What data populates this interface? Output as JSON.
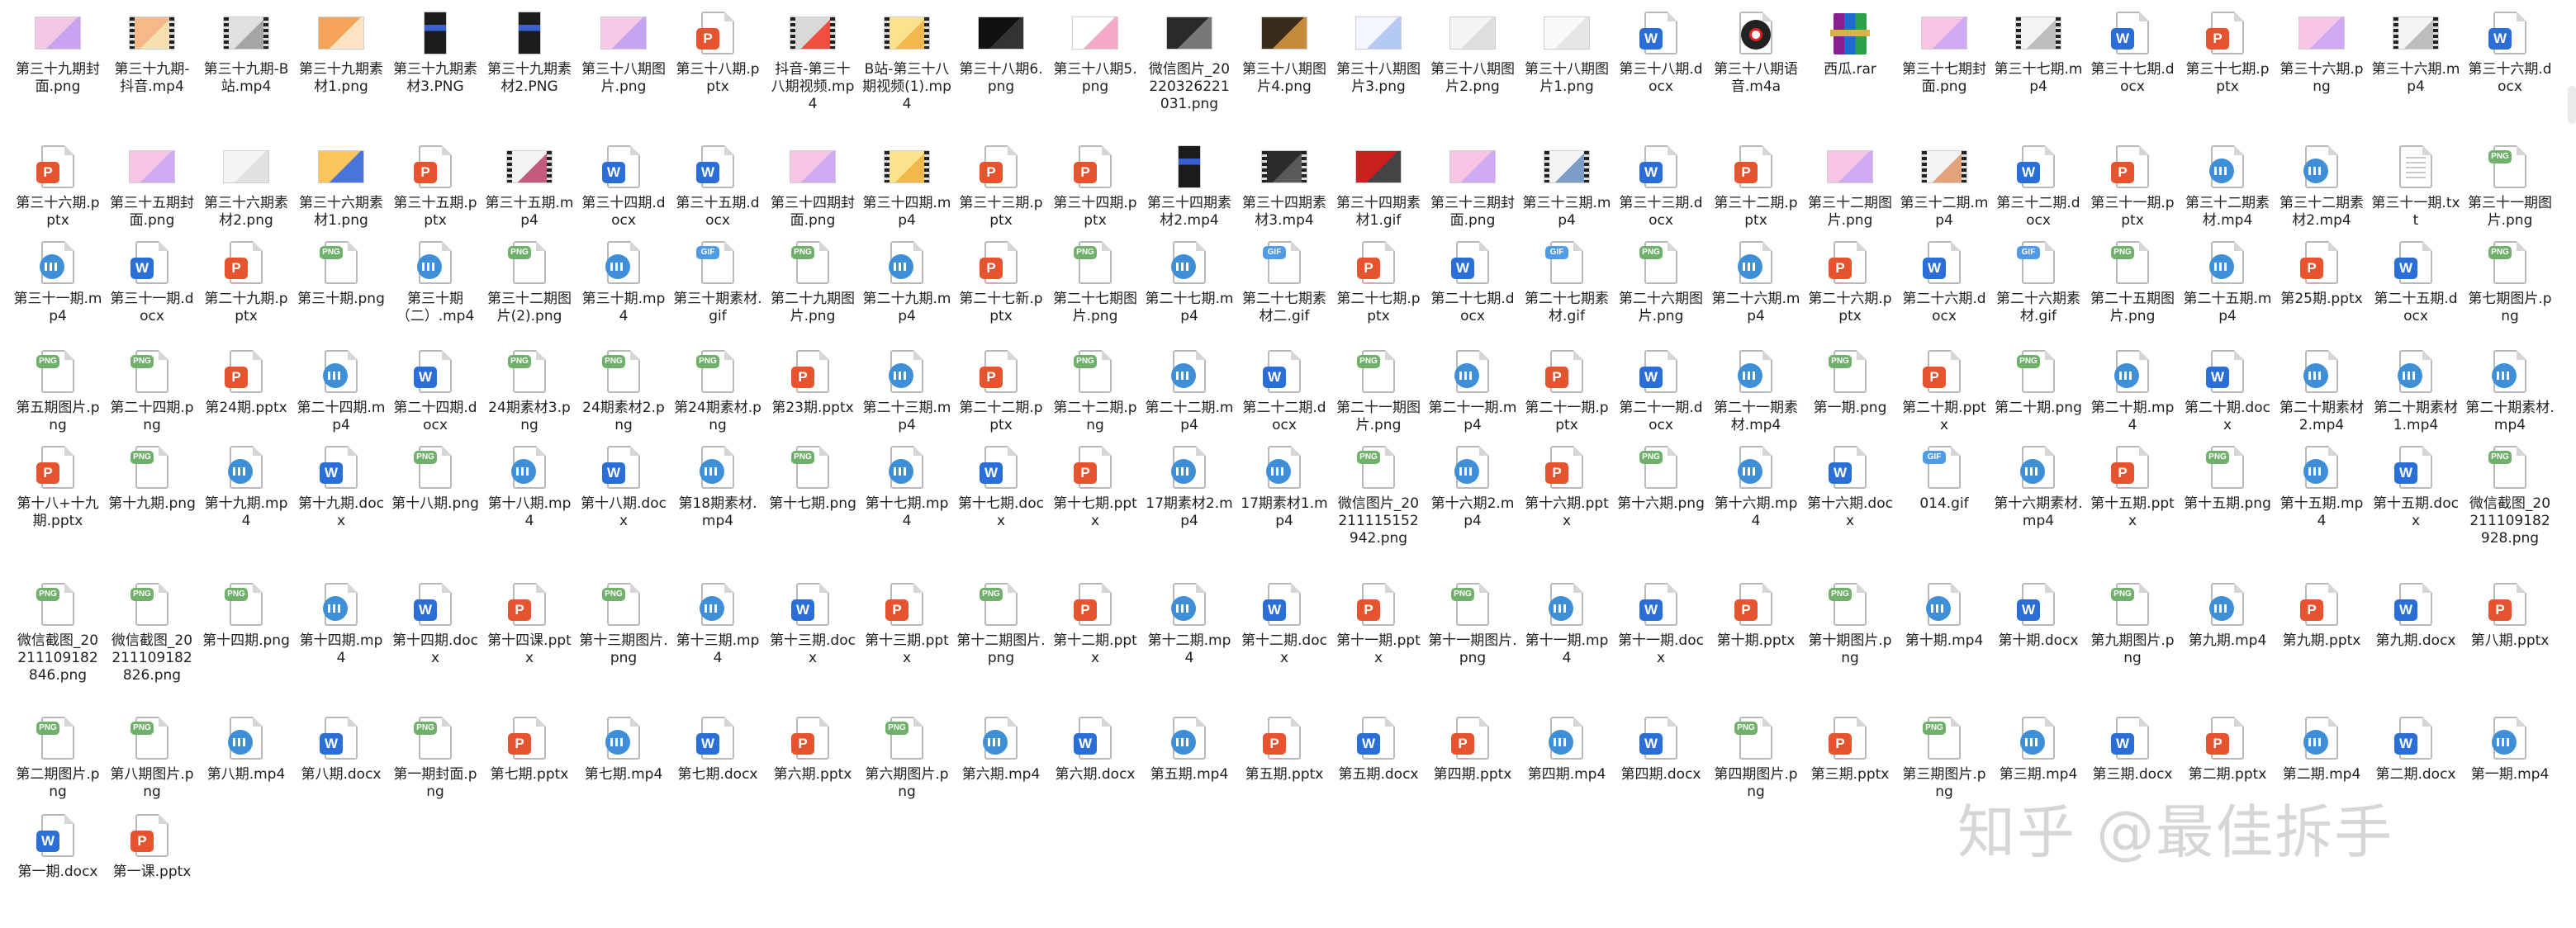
{
  "colors": {
    "docx": "#2b6fd6",
    "pptx": "#e5532f",
    "png": "#6fb06a",
    "gif": "#4f9be6",
    "mp4": "#3f8ed8"
  },
  "watermark": "知乎 @最佳拆手",
  "files": [
    {
      "name": "第三十九期封面.png",
      "type": "thumb",
      "thumb": [
        "#f4c7e7",
        "#c9a3f0"
      ]
    },
    {
      "name": "第三十九期-抖音.mp4",
      "type": "video",
      "thumb": [
        "#f7b989",
        "#f7e0b0"
      ]
    },
    {
      "name": "第三十九期-B站.mp4",
      "type": "video",
      "thumb": [
        "#e0e0e0",
        "#a5a5a5"
      ]
    },
    {
      "name": "第三十九期素材1.png",
      "type": "thumb",
      "thumb": [
        "#f6a45a",
        "#ffe3c3"
      ]
    },
    {
      "name": "第三十九期素材3.PNG",
      "type": "portrait"
    },
    {
      "name": "第三十九期素材2.PNG",
      "type": "portrait"
    },
    {
      "name": "第三十八期图片.png",
      "type": "thumb",
      "thumb": [
        "#f7c9e6",
        "#c6a4ef"
      ]
    },
    {
      "name": "第三十八期.pptx",
      "type": "pptx"
    },
    {
      "name": "抖音-第三十八期视频.mp4",
      "type": "video",
      "thumb": [
        "#d9d9d9",
        "#f04e3e"
      ]
    },
    {
      "name": "B站-第三十八期视频(1).mp4",
      "type": "video",
      "thumb": [
        "#fbe38b",
        "#f2b84b"
      ]
    },
    {
      "name": "第三十八期6.png",
      "type": "thumb",
      "thumb": [
        "#111111",
        "#333333"
      ]
    },
    {
      "name": "第三十八期5.png",
      "type": "thumb",
      "thumb": [
        "#ffffff",
        "#f5a9c8"
      ]
    },
    {
      "name": "微信图片_20220326221031.png",
      "type": "thumb",
      "thumb": [
        "#2a2a2a",
        "#777777"
      ]
    },
    {
      "name": "第三十八期图片4.png",
      "type": "thumb",
      "thumb": [
        "#3a2c1d",
        "#c58a3b"
      ]
    },
    {
      "name": "第三十八期图片3.png",
      "type": "thumb",
      "thumb": [
        "#f4f7ff",
        "#b5c9f5"
      ]
    },
    {
      "name": "第三十八期图片2.png",
      "type": "thumb",
      "thumb": [
        "#f4f4f4",
        "#dedede"
      ]
    },
    {
      "name": "第三十八期图片1.png",
      "type": "thumb",
      "thumb": [
        "#fafafa",
        "#e6e6e6"
      ]
    },
    {
      "name": "第三十八期.docx",
      "type": "docx"
    },
    {
      "name": "第三十八期语音.m4a",
      "type": "audio"
    },
    {
      "name": "西瓜.rar",
      "type": "rar"
    },
    {
      "name": "第三十七期封面.png",
      "type": "thumb",
      "thumb": [
        "#f7c5e3",
        "#cfa9f2"
      ]
    },
    {
      "name": "第三十七期.mp4",
      "type": "video",
      "thumb": [
        "#f3f3f3",
        "#bdbdbd"
      ]
    },
    {
      "name": "第三十七期.docx",
      "type": "docx"
    },
    {
      "name": "第三十七期.pptx",
      "type": "pptx"
    },
    {
      "name": "第三十六期.png",
      "type": "thumb",
      "thumb": [
        "#f6c5e4",
        "#cfa9f2"
      ]
    },
    {
      "name": "第三十六期.mp4",
      "type": "video",
      "thumb": [
        "#f3f3f3",
        "#bdbdbd"
      ]
    },
    {
      "name": "第三十六期.docx",
      "type": "docx"
    },
    {
      "name": "第三十六期.pptx",
      "type": "pptx"
    },
    {
      "name": "第三十五期封面.png",
      "type": "thumb",
      "thumb": [
        "#f6c5e4",
        "#cfa9f2"
      ]
    },
    {
      "name": "第三十六期素材2.png",
      "type": "thumb",
      "thumb": [
        "#f5f5f5",
        "#e2e2e2"
      ]
    },
    {
      "name": "第三十六期素材1.png",
      "type": "thumb",
      "thumb": [
        "#fbc55c",
        "#4a74d9"
      ]
    },
    {
      "name": "第三十五期.pptx",
      "type": "pptx"
    },
    {
      "name": "第三十五期.mp4",
      "type": "video",
      "thumb": [
        "#f3f3f3",
        "#c25a80"
      ]
    },
    {
      "name": "第三十四期.docx",
      "type": "docx"
    },
    {
      "name": "第三十五期.docx",
      "type": "docx"
    },
    {
      "name": "第三十四期封面.png",
      "type": "thumb",
      "thumb": [
        "#f6c5e4",
        "#cfa9f2"
      ]
    },
    {
      "name": "第三十四期.mp4",
      "type": "video",
      "thumb": [
        "#fbe38b",
        "#f2b84b"
      ]
    },
    {
      "name": "第三十三期.pptx",
      "type": "pptx"
    },
    {
      "name": "第三十四期.pptx",
      "type": "pptx"
    },
    {
      "name": "第三十四期素材2.mp4",
      "type": "portrait"
    },
    {
      "name": "第三十四期素材3.mp4",
      "type": "video",
      "thumb": [
        "#2a2a2a",
        "#5a5a5a"
      ]
    },
    {
      "name": "第三十四期素材1.gif",
      "type": "thumb",
      "thumb": [
        "#cc2020",
        "#444444"
      ]
    },
    {
      "name": "第三十三期封面.png",
      "type": "thumb",
      "thumb": [
        "#f6c5e4",
        "#cfa9f2"
      ]
    },
    {
      "name": "第三十三期.mp4",
      "type": "video",
      "thumb": [
        "#f3f3f3",
        "#7a9cc9"
      ]
    },
    {
      "name": "第三十三期.docx",
      "type": "docx"
    },
    {
      "name": "第三十二期.pptx",
      "type": "pptx"
    },
    {
      "name": "第三十二期图片.png",
      "type": "thumb",
      "thumb": [
        "#f6c5e4",
        "#cfa9f2"
      ]
    },
    {
      "name": "第三十二期.mp4",
      "type": "video",
      "thumb": [
        "#f3f3f3",
        "#e2a27a"
      ]
    },
    {
      "name": "第三十二期.docx",
      "type": "docx"
    },
    {
      "name": "第三十一期.pptx",
      "type": "pptx"
    },
    {
      "name": "第三十二期素材.mp4",
      "type": "mp4"
    },
    {
      "name": "第三十二期素材2.mp4",
      "type": "mp4"
    },
    {
      "name": "第三十一期.txt",
      "type": "txt"
    },
    {
      "name": "第三十一期图片.png",
      "type": "png"
    },
    {
      "name": "第三十一期.mp4",
      "type": "mp4"
    },
    {
      "name": "第三十一期.docx",
      "type": "docx"
    },
    {
      "name": "第二十九期.pptx",
      "type": "pptx"
    },
    {
      "name": "第三十期.png",
      "type": "png"
    },
    {
      "name": "第三十期（二）.mp4",
      "type": "mp4"
    },
    {
      "name": "第三十二期图片(2).png",
      "type": "png"
    },
    {
      "name": "第三十期.mp4",
      "type": "mp4"
    },
    {
      "name": "第三十期素材.gif",
      "type": "gif"
    },
    {
      "name": "第二十九期图片.png",
      "type": "png"
    },
    {
      "name": "第二十九期.mp4",
      "type": "mp4"
    },
    {
      "name": "第二十七新.pptx",
      "type": "pptx"
    },
    {
      "name": "第二十七期图片.png",
      "type": "png"
    },
    {
      "name": "第二十七期.mp4",
      "type": "mp4"
    },
    {
      "name": "第二十七期素材二.gif",
      "type": "gif"
    },
    {
      "name": "第二十七期.pptx",
      "type": "pptx"
    },
    {
      "name": "第二十七期.docx",
      "type": "docx"
    },
    {
      "name": "第二十七期素材.gif",
      "type": "gif"
    },
    {
      "name": "第二十六期图片.png",
      "type": "png"
    },
    {
      "name": "第二十六期.mp4",
      "type": "mp4"
    },
    {
      "name": "第二十六期.pptx",
      "type": "pptx"
    },
    {
      "name": "第二十六期.docx",
      "type": "docx"
    },
    {
      "name": "第二十六期素材.gif",
      "type": "gif"
    },
    {
      "name": "第二十五期图片.png",
      "type": "png"
    },
    {
      "name": "第二十五期.mp4",
      "type": "mp4"
    },
    {
      "name": "第25期.pptx",
      "type": "pptx"
    },
    {
      "name": "第二十五期.docx",
      "type": "docx"
    },
    {
      "name": "第七期图片.png",
      "type": "png"
    },
    {
      "name": "第五期图片.png",
      "type": "png"
    },
    {
      "name": "第二十四期.png",
      "type": "png"
    },
    {
      "name": "第24期.pptx",
      "type": "pptx"
    },
    {
      "name": "第二十四期.mp4",
      "type": "mp4"
    },
    {
      "name": "第二十四期.docx",
      "type": "docx"
    },
    {
      "name": "24期素材3.png",
      "type": "png"
    },
    {
      "name": "24期素材2.png",
      "type": "png"
    },
    {
      "name": "第24期素材.png",
      "type": "png"
    },
    {
      "name": "第23期.pptx",
      "type": "pptx"
    },
    {
      "name": "第二十三期.mp4",
      "type": "mp4"
    },
    {
      "name": "第二十二期.pptx",
      "type": "pptx"
    },
    {
      "name": "第二十二期.png",
      "type": "png"
    },
    {
      "name": "第二十二期.mp4",
      "type": "mp4"
    },
    {
      "name": "第二十二期.docx",
      "type": "docx"
    },
    {
      "name": "第二十一期图片.png",
      "type": "png"
    },
    {
      "name": "第二十一期.mp4",
      "type": "mp4"
    },
    {
      "name": "第二十一期.pptx",
      "type": "pptx"
    },
    {
      "name": "第二十一期.docx",
      "type": "docx"
    },
    {
      "name": "第二十一期素材.mp4",
      "type": "mp4"
    },
    {
      "name": "第一期.png",
      "type": "png"
    },
    {
      "name": "第二十期.pptx",
      "type": "pptx"
    },
    {
      "name": "第二十期.png",
      "type": "png"
    },
    {
      "name": "第二十期.mp4",
      "type": "mp4"
    },
    {
      "name": "第二十期.docx",
      "type": "docx"
    },
    {
      "name": "第二十期素材2.mp4",
      "type": "mp4"
    },
    {
      "name": "第二十期素材1.mp4",
      "type": "mp4"
    },
    {
      "name": "第二十期素材.mp4",
      "type": "mp4"
    },
    {
      "name": "第十八+十九期.pptx",
      "type": "pptx"
    },
    {
      "name": "第十九期.png",
      "type": "png"
    },
    {
      "name": "第十九期.mp4",
      "type": "mp4"
    },
    {
      "name": "第十九期.docx",
      "type": "docx"
    },
    {
      "name": "第十八期.png",
      "type": "png"
    },
    {
      "name": "第十八期.mp4",
      "type": "mp4"
    },
    {
      "name": "第十八期.docx",
      "type": "docx"
    },
    {
      "name": "第18期素材.mp4",
      "type": "mp4"
    },
    {
      "name": "第十七期.png",
      "type": "png"
    },
    {
      "name": "第十七期.mp4",
      "type": "mp4"
    },
    {
      "name": "第十七期.docx",
      "type": "docx"
    },
    {
      "name": "第十七期.pptx",
      "type": "pptx"
    },
    {
      "name": "17期素材2.mp4",
      "type": "mp4"
    },
    {
      "name": "17期素材1.mp4",
      "type": "mp4"
    },
    {
      "name": "微信图片_20211115152942.png",
      "type": "png"
    },
    {
      "name": "第十六期2.mp4",
      "type": "mp4"
    },
    {
      "name": "第十六期.pptx",
      "type": "pptx"
    },
    {
      "name": "第十六期.png",
      "type": "png"
    },
    {
      "name": "第十六期.mp4",
      "type": "mp4"
    },
    {
      "name": "第十六期.docx",
      "type": "docx"
    },
    {
      "name": "014.gif",
      "type": "gif"
    },
    {
      "name": "第十六期素材.mp4",
      "type": "mp4"
    },
    {
      "name": "第十五期.pptx",
      "type": "pptx"
    },
    {
      "name": "第十五期.png",
      "type": "png"
    },
    {
      "name": "第十五期.mp4",
      "type": "mp4"
    },
    {
      "name": "第十五期.docx",
      "type": "docx"
    },
    {
      "name": "微信截图_20211109182928.png",
      "type": "png"
    },
    {
      "name": "微信截图_20211109182846.png",
      "type": "png"
    },
    {
      "name": "微信截图_20211109182826.png",
      "type": "png"
    },
    {
      "name": "第十四期.png",
      "type": "png"
    },
    {
      "name": "第十四期.mp4",
      "type": "mp4"
    },
    {
      "name": "第十四期.docx",
      "type": "docx"
    },
    {
      "name": "第十四课.pptx",
      "type": "pptx"
    },
    {
      "name": "第十三期图片.png",
      "type": "png"
    },
    {
      "name": "第十三期.mp4",
      "type": "mp4"
    },
    {
      "name": "第十三期.docx",
      "type": "docx"
    },
    {
      "name": "第十三期.pptx",
      "type": "pptx"
    },
    {
      "name": "第十二期图片.png",
      "type": "png"
    },
    {
      "name": "第十二期.pptx",
      "type": "pptx"
    },
    {
      "name": "第十二期.mp4",
      "type": "mp4"
    },
    {
      "name": "第十二期.docx",
      "type": "docx"
    },
    {
      "name": "第十一期.pptx",
      "type": "pptx"
    },
    {
      "name": "第十一期图片.png",
      "type": "png"
    },
    {
      "name": "第十一期.mp4",
      "type": "mp4"
    },
    {
      "name": "第十一期.docx",
      "type": "docx"
    },
    {
      "name": "第十期.pptx",
      "type": "pptx"
    },
    {
      "name": "第十期图片.png",
      "type": "png"
    },
    {
      "name": "第十期.mp4",
      "type": "mp4"
    },
    {
      "name": "第十期.docx",
      "type": "docx"
    },
    {
      "name": "第九期图片.png",
      "type": "png"
    },
    {
      "name": "第九期.mp4",
      "type": "mp4"
    },
    {
      "name": "第九期.pptx",
      "type": "pptx"
    },
    {
      "name": "第九期.docx",
      "type": "docx"
    },
    {
      "name": "第八期.pptx",
      "type": "pptx"
    },
    {
      "name": "第二期图片.png",
      "type": "png"
    },
    {
      "name": "第八期图片.png",
      "type": "png"
    },
    {
      "name": "第八期.mp4",
      "type": "mp4"
    },
    {
      "name": "第八期.docx",
      "type": "docx"
    },
    {
      "name": "第一期封面.png",
      "type": "png"
    },
    {
      "name": "第七期.pptx",
      "type": "pptx"
    },
    {
      "name": "第七期.mp4",
      "type": "mp4"
    },
    {
      "name": "第七期.docx",
      "type": "docx"
    },
    {
      "name": "第六期.pptx",
      "type": "pptx"
    },
    {
      "name": "第六期图片.png",
      "type": "png"
    },
    {
      "name": "第六期.mp4",
      "type": "mp4"
    },
    {
      "name": "第六期.docx",
      "type": "docx"
    },
    {
      "name": "第五期.mp4",
      "type": "mp4"
    },
    {
      "name": "第五期.pptx",
      "type": "pptx"
    },
    {
      "name": "第五期.docx",
      "type": "docx"
    },
    {
      "name": "第四期.pptx",
      "type": "pptx"
    },
    {
      "name": "第四期.mp4",
      "type": "mp4"
    },
    {
      "name": "第四期.docx",
      "type": "docx"
    },
    {
      "name": "第四期图片.png",
      "type": "png"
    },
    {
      "name": "第三期.pptx",
      "type": "pptx"
    },
    {
      "name": "第三期图片.png",
      "type": "png"
    },
    {
      "name": "第三期.mp4",
      "type": "mp4"
    },
    {
      "name": "第三期.docx",
      "type": "docx"
    },
    {
      "name": "第二期.pptx",
      "type": "pptx"
    },
    {
      "name": "第二期.mp4",
      "type": "mp4"
    },
    {
      "name": "第二期.docx",
      "type": "docx"
    },
    {
      "name": "第一期.mp4",
      "type": "mp4"
    },
    {
      "name": "第一期.docx",
      "type": "docx"
    },
    {
      "name": "第一课.pptx",
      "type": "pptx"
    }
  ]
}
